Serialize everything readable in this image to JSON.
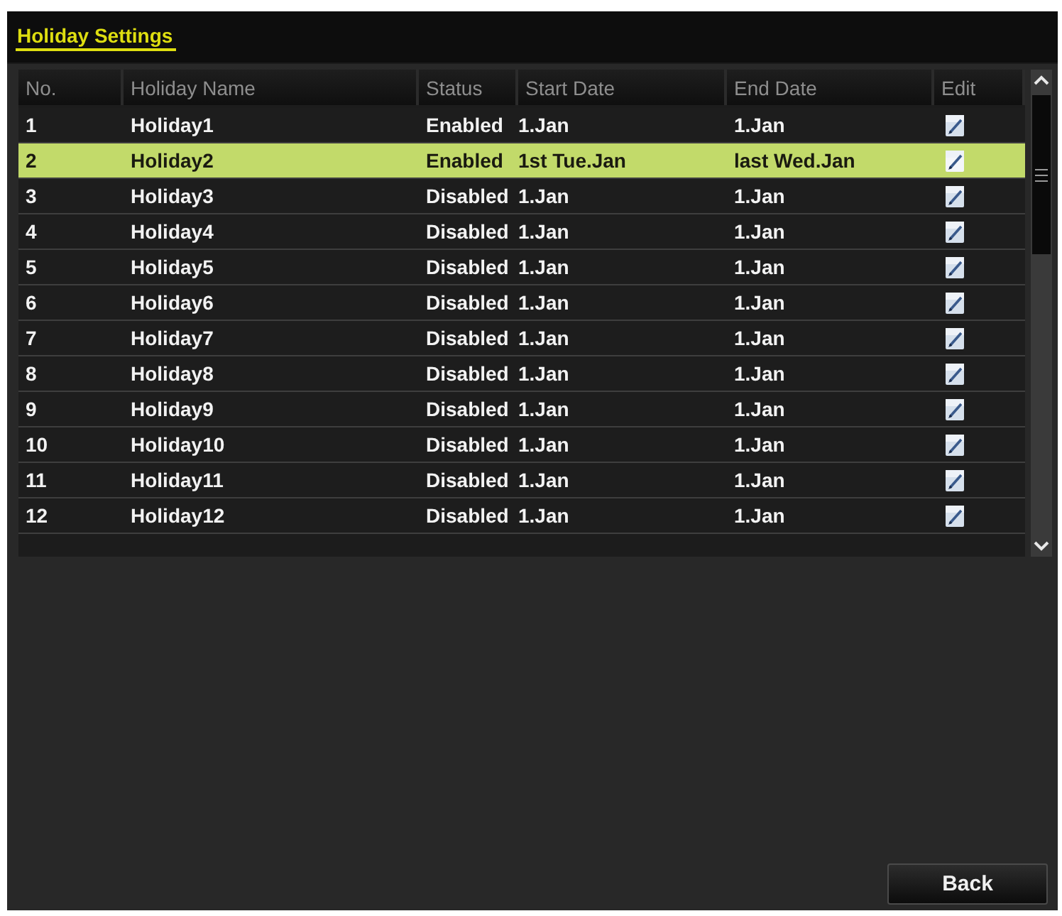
{
  "title": "Holiday Settings",
  "table": {
    "columns": [
      "No.",
      "Holiday Name",
      "Status",
      "Start Date",
      "End Date",
      "Edit"
    ],
    "rows": [
      {
        "no": "1",
        "name": "Holiday1",
        "status": "Enabled",
        "start_date": "1.Jan",
        "end_date": "1.Jan",
        "selected": false
      },
      {
        "no": "2",
        "name": "Holiday2",
        "status": "Enabled",
        "start_date": "1st Tue.Jan",
        "end_date": "last Wed.Jan",
        "selected": true
      },
      {
        "no": "3",
        "name": "Holiday3",
        "status": "Disabled",
        "start_date": "1.Jan",
        "end_date": "1.Jan",
        "selected": false
      },
      {
        "no": "4",
        "name": "Holiday4",
        "status": "Disabled",
        "start_date": "1.Jan",
        "end_date": "1.Jan",
        "selected": false
      },
      {
        "no": "5",
        "name": "Holiday5",
        "status": "Disabled",
        "start_date": "1.Jan",
        "end_date": "1.Jan",
        "selected": false
      },
      {
        "no": "6",
        "name": "Holiday6",
        "status": "Disabled",
        "start_date": "1.Jan",
        "end_date": "1.Jan",
        "selected": false
      },
      {
        "no": "7",
        "name": "Holiday7",
        "status": "Disabled",
        "start_date": "1.Jan",
        "end_date": "1.Jan",
        "selected": false
      },
      {
        "no": "8",
        "name": "Holiday8",
        "status": "Disabled",
        "start_date": "1.Jan",
        "end_date": "1.Jan",
        "selected": false
      },
      {
        "no": "9",
        "name": "Holiday9",
        "status": "Disabled",
        "start_date": "1.Jan",
        "end_date": "1.Jan",
        "selected": false
      },
      {
        "no": "10",
        "name": "Holiday10",
        "status": "Disabled",
        "start_date": "1.Jan",
        "end_date": "1.Jan",
        "selected": false
      },
      {
        "no": "11",
        "name": "Holiday11",
        "status": "Disabled",
        "start_date": "1.Jan",
        "end_date": "1.Jan",
        "selected": false
      },
      {
        "no": "12",
        "name": "Holiday12",
        "status": "Disabled",
        "start_date": "1.Jan",
        "end_date": "1.Jan",
        "selected": false
      }
    ]
  },
  "buttons": [
    {
      "label": "Back"
    }
  ]
}
